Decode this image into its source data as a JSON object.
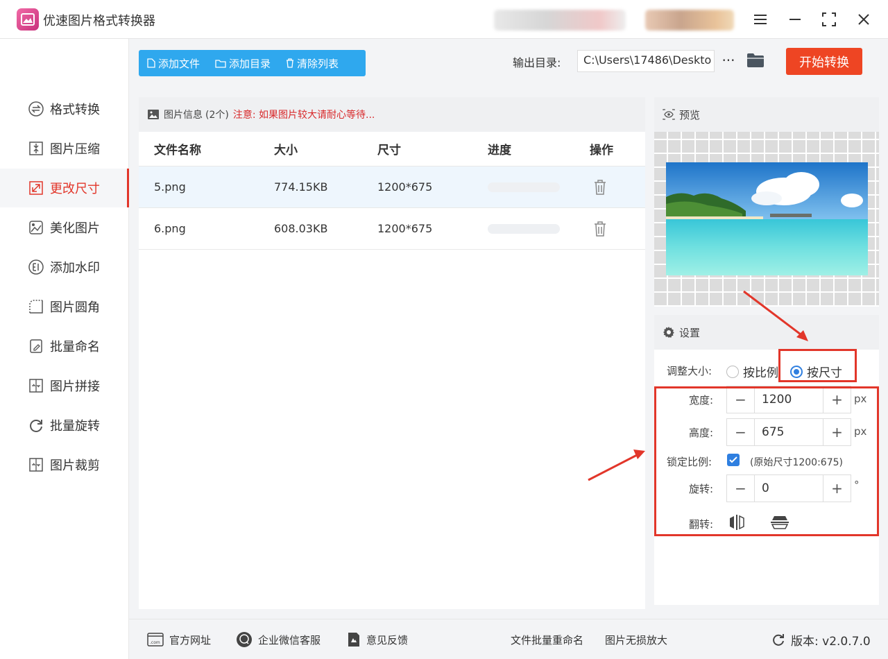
{
  "app": {
    "title": "优速图片格式转换器"
  },
  "sidebar": {
    "items": [
      {
        "label": "格式转换",
        "icon": "swap-circle-icon"
      },
      {
        "label": "图片压缩",
        "icon": "compress-icon"
      },
      {
        "label": "更改尺寸",
        "icon": "resize-icon",
        "active": true
      },
      {
        "label": "美化图片",
        "icon": "beautify-icon"
      },
      {
        "label": "添加水印",
        "icon": "watermark-icon"
      },
      {
        "label": "图片圆角",
        "icon": "rounded-corner-icon"
      },
      {
        "label": "批量命名",
        "icon": "rename-icon"
      },
      {
        "label": "图片拼接",
        "icon": "merge-icon"
      },
      {
        "label": "批量旋转",
        "icon": "rotate-icon"
      },
      {
        "label": "图片裁剪",
        "icon": "crop-icon"
      }
    ]
  },
  "toolbar": {
    "add_file": "添加文件",
    "add_folder": "添加目录",
    "clear_list": "清除列表",
    "output_label": "输出目录:",
    "output_path": "C:\\Users\\17486\\Deskto",
    "more": "···",
    "start": "开始转换"
  },
  "file_panel": {
    "title": "图片信息",
    "count": "(2个)",
    "warning": "注意: 如果图片较大请耐心等待...",
    "columns": {
      "name": "文件名称",
      "size": "大小",
      "dim": "尺寸",
      "progress": "进度",
      "action": "操作"
    },
    "rows": [
      {
        "name": "5.png",
        "size": "774.15KB",
        "dim": "1200*675",
        "progress": 0
      },
      {
        "name": "6.png",
        "size": "608.03KB",
        "dim": "1200*675",
        "progress": 0
      }
    ]
  },
  "preview": {
    "title": "预览"
  },
  "settings": {
    "title": "设置",
    "resize_label": "调整大小:",
    "by_ratio": "按比例",
    "by_size": "按尺寸",
    "width_label": "宽度:",
    "width_value": "1200",
    "height_label": "高度:",
    "height_value": "675",
    "px": "px",
    "lock_label": "锁定比例:",
    "lock_note": "(原始尺寸1200:675)",
    "rotate_label": "旋转:",
    "rotate_value": "0",
    "degree": "°",
    "flip_label": "翻转:",
    "minus": "−",
    "plus": "+"
  },
  "footer": {
    "website": "官方网址",
    "wechat": "企业微信客服",
    "feedback": "意见反馈",
    "batch_rename": "文件批量重命名",
    "lossless": "图片无损放大",
    "version": "版本:  v2.0.7.0"
  },
  "colors": {
    "accent": "#2fa8ee",
    "start": "#ee4523",
    "active": "#e2362a",
    "annotation": "#e2362a"
  }
}
